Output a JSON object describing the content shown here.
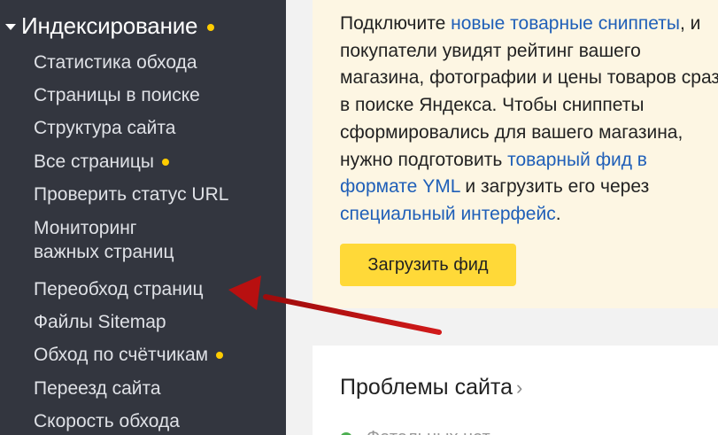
{
  "sidebar": {
    "section_title": "Индексирование",
    "items": [
      {
        "label": "Статистика обхода",
        "has_dot": false
      },
      {
        "label": "Страницы в поиске",
        "has_dot": false
      },
      {
        "label": "Структура сайта",
        "has_dot": false
      },
      {
        "label": "Все страницы",
        "has_dot": true
      },
      {
        "label": "Проверить статус URL",
        "has_dot": false
      },
      {
        "label": "Мониторинг",
        "has_dot": false
      },
      {
        "label": "важных страниц",
        "has_dot": false
      },
      {
        "label": "Переобход страниц",
        "has_dot": false
      },
      {
        "label": "Файлы Sitemap",
        "has_dot": false
      },
      {
        "label": "Обход по счётчикам",
        "has_dot": true
      },
      {
        "label": "Переезд сайта",
        "has_dot": false
      },
      {
        "label": "Скорость обхода",
        "has_dot": false
      }
    ]
  },
  "promo": {
    "text_1": "Подключите ",
    "link_1": "новые товарные сниппеты",
    "text_2": ", и покупатели увидят рейтинг вашего магазина, фотографии и цены товаров сразу в поиске Яндекса. Чтобы сниппеты сформировались для вашего магазина, нужно подготовить ",
    "link_2": "товарный фид в формате YML",
    "text_3": " и загрузить его через ",
    "link_3": "специальный интерфейс",
    "text_4": ".",
    "button_label": "Загрузить фид"
  },
  "issues": {
    "title": "Проблемы сайта",
    "chevron": "›",
    "row_label": "Фатальных нет"
  },
  "colors": {
    "sidebar_bg": "#33363f",
    "notification_dot": "#ffcc00",
    "promo_bg": "#fdf6e3",
    "link": "#1f5fb8",
    "button_bg": "#ffd938",
    "arrow": "#c41212",
    "status_ok": "#4caf50"
  }
}
